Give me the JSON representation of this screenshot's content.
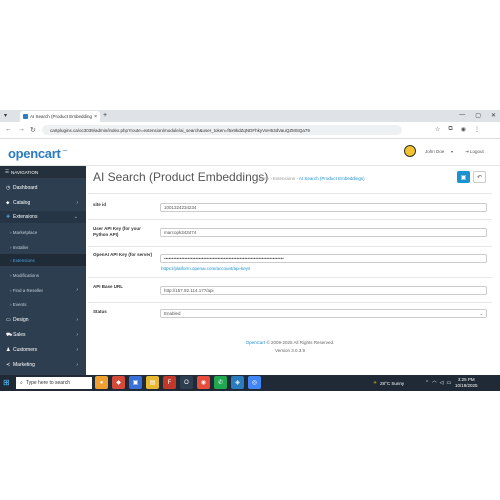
{
  "browser": {
    "tab_title": "AI Search (Product Embeddings)",
    "url": "cartplugins.ca/oc3039/admin/index.php?route=extension/module/ai_search&user_token=f5x9kdZqNDFhkyVoH53dVauQZMSQa79",
    "new_tab": "+",
    "window_controls": [
      "—",
      "▢",
      "✕"
    ]
  },
  "header": {
    "logo": "opencart",
    "user_name": "John Doe",
    "logout": "Logout"
  },
  "sidebar": {
    "heading": "NAVIGATION",
    "items": [
      {
        "label": "Dashboard",
        "icon": "dashboard-icon"
      },
      {
        "label": "Catalog",
        "icon": "tag-icon"
      },
      {
        "label": "Extensions",
        "icon": "puzzle-icon"
      },
      {
        "label": "Marketplace"
      },
      {
        "label": "Installer"
      },
      {
        "label": "Extensions"
      },
      {
        "label": "Modifications"
      },
      {
        "label": "Events"
      },
      {
        "label": "Design",
        "icon": "desktop-icon"
      },
      {
        "label": "Sales",
        "icon": "cart-icon"
      },
      {
        "label": "Customers",
        "icon": "user-icon"
      },
      {
        "label": "Marketing",
        "icon": "share-icon"
      }
    ],
    "sub_find": "Find a Reseller"
  },
  "page": {
    "title": "AI Search (Product Embeddings)",
    "breadcrumb": [
      "Home",
      "Extensions",
      "AI Search (Product Embeddings)"
    ]
  },
  "form": {
    "site_id_label": "site id",
    "site_id_value": "1001324234234",
    "user_api_label": "User API Key (for your Python API)",
    "user_api_value": "marcopk343474",
    "openai_label": "OpenAI API Key (for server)",
    "openai_value": "••••••••••••••••••••••••••••••••••••••••••••••••••••••••••••••••••••••••••••",
    "openai_help": "https://platform.openai.com/account/api-keys",
    "api_base_label": "API Base URL",
    "api_base_value": "http://157.92.114.177/api",
    "status_label": "Status",
    "status_value": "Enabled"
  },
  "footer": {
    "brand": "OpenCart",
    "copyright": "© 2009-2025 All Rights Reserved.",
    "version": "Version 3.0.3.9"
  },
  "taskbar": {
    "search_placeholder": "Type here to search",
    "weather": "28°C  Sunny",
    "time": "3:25 PM",
    "date": "10/19/2025"
  },
  "colors": {
    "accent": "#1e91cf",
    "sidebar": "#2d3e50",
    "logo": "#2b7bbf"
  }
}
